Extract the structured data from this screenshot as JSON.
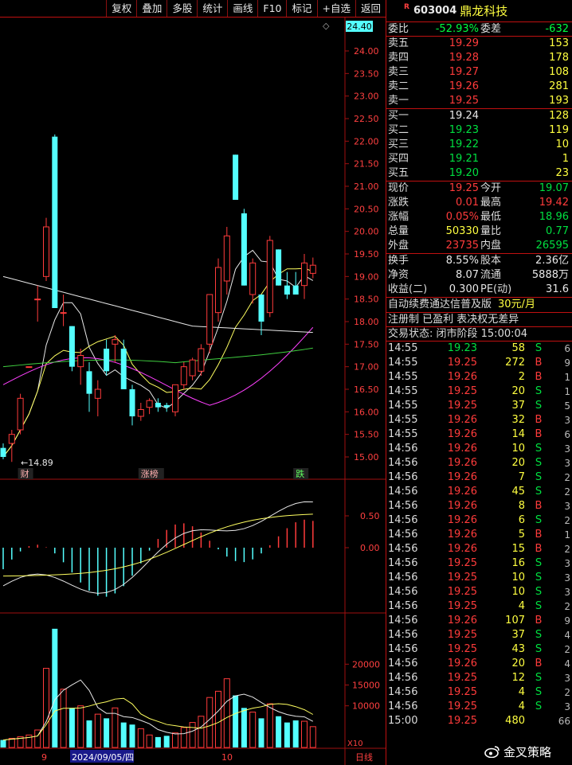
{
  "toolbar": {
    "buttons": [
      "复权",
      "叠加",
      "多股",
      "统计",
      "画线",
      "F10",
      "标记",
      "+自选",
      "返回"
    ]
  },
  "stock": {
    "badge": "R",
    "code": "603004",
    "name": "鼎龙科技"
  },
  "weibi": {
    "label1": "委比",
    "value1": "-52.93%",
    "label2": "委差",
    "value2": "-632"
  },
  "sell": [
    {
      "label": "卖五",
      "price": "19.29",
      "vol": "153"
    },
    {
      "label": "卖四",
      "price": "19.28",
      "vol": "178"
    },
    {
      "label": "卖三",
      "price": "19.27",
      "vol": "108"
    },
    {
      "label": "卖二",
      "price": "19.26",
      "vol": "281"
    },
    {
      "label": "卖一",
      "price": "19.25",
      "vol": "193"
    }
  ],
  "buy": [
    {
      "label": "买一",
      "price": "19.24",
      "vol": "128",
      "color": "white"
    },
    {
      "label": "买二",
      "price": "19.23",
      "vol": "119",
      "color": "green"
    },
    {
      "label": "买三",
      "price": "19.22",
      "vol": "10",
      "color": "green"
    },
    {
      "label": "买四",
      "price": "19.21",
      "vol": "1",
      "color": "green"
    },
    {
      "label": "买五",
      "price": "19.20",
      "vol": "23",
      "color": "green"
    }
  ],
  "quote": [
    {
      "l1": "现价",
      "v1": "19.25",
      "c1": "red",
      "l2": "今开",
      "v2": "19.07",
      "c2": "green"
    },
    {
      "l1": "涨跌",
      "v1": "0.01",
      "c1": "red",
      "l2": "最高",
      "v2": "19.42",
      "c2": "red"
    },
    {
      "l1": "涨幅",
      "v1": "0.05%",
      "c1": "red",
      "l2": "最低",
      "v2": "18.96",
      "c2": "green"
    },
    {
      "l1": "总量",
      "v1": "50330",
      "c1": "yellow",
      "l2": "量比",
      "v2": "0.77",
      "c2": "green"
    },
    {
      "l1": "外盘",
      "v1": "23735",
      "c1": "red",
      "l2": "内盘",
      "v2": "26595",
      "c2": "green"
    }
  ],
  "fundamentals": [
    {
      "l1": "换手",
      "v1": "8.55%",
      "l2": "股本",
      "v2": "2.36亿"
    },
    {
      "l1": "净资",
      "v1": "8.07",
      "l2": "流通",
      "v2": "5888万"
    },
    {
      "l1": "收益(二)",
      "v1": "0.300",
      "l2": "PE(动)",
      "v2": "31.6"
    }
  ],
  "notice": {
    "line1_a": "自动续费通达信普及版",
    "line1_b": "30元/月",
    "line2": "注册制 已盈利 表决权无差异",
    "line3": "交易状态: 闭市阶段 15:00:04"
  },
  "ticks": [
    {
      "t": "14:55",
      "p": "19.23",
      "pc": "green",
      "v": "58",
      "bs": "S",
      "n": "6"
    },
    {
      "t": "14:55",
      "p": "19.25",
      "pc": "red",
      "v": "272",
      "bs": "B",
      "n": "9"
    },
    {
      "t": "14:55",
      "p": "19.26",
      "pc": "red",
      "v": "2",
      "bs": "B",
      "n": "1"
    },
    {
      "t": "14:55",
      "p": "19.25",
      "pc": "red",
      "v": "20",
      "bs": "S",
      "n": "1"
    },
    {
      "t": "14:55",
      "p": "19.25",
      "pc": "red",
      "v": "37",
      "bs": "S",
      "n": "5"
    },
    {
      "t": "14:55",
      "p": "19.26",
      "pc": "red",
      "v": "32",
      "bs": "B",
      "n": "3"
    },
    {
      "t": "14:55",
      "p": "19.26",
      "pc": "red",
      "v": "14",
      "bs": "B",
      "n": "6"
    },
    {
      "t": "14:56",
      "p": "19.26",
      "pc": "red",
      "v": "10",
      "bs": "S",
      "n": "3"
    },
    {
      "t": "14:56",
      "p": "19.26",
      "pc": "red",
      "v": "20",
      "bs": "S",
      "n": "3"
    },
    {
      "t": "14:56",
      "p": "19.26",
      "pc": "red",
      "v": "7",
      "bs": "S",
      "n": "2"
    },
    {
      "t": "14:56",
      "p": "19.26",
      "pc": "red",
      "v": "45",
      "bs": "S",
      "n": "2"
    },
    {
      "t": "14:56",
      "p": "19.26",
      "pc": "red",
      "v": "8",
      "bs": "B",
      "n": "3"
    },
    {
      "t": "14:56",
      "p": "19.26",
      "pc": "red",
      "v": "6",
      "bs": "S",
      "n": "2"
    },
    {
      "t": "14:56",
      "p": "19.26",
      "pc": "red",
      "v": "5",
      "bs": "B",
      "n": "1"
    },
    {
      "t": "14:56",
      "p": "19.26",
      "pc": "red",
      "v": "15",
      "bs": "B",
      "n": "2"
    },
    {
      "t": "14:56",
      "p": "19.25",
      "pc": "red",
      "v": "16",
      "bs": "S",
      "n": "3"
    },
    {
      "t": "14:56",
      "p": "19.25",
      "pc": "red",
      "v": "10",
      "bs": "S",
      "n": "3"
    },
    {
      "t": "14:56",
      "p": "19.25",
      "pc": "red",
      "v": "10",
      "bs": "S",
      "n": "3"
    },
    {
      "t": "14:56",
      "p": "19.25",
      "pc": "red",
      "v": "4",
      "bs": "S",
      "n": "2"
    },
    {
      "t": "14:56",
      "p": "19.26",
      "pc": "red",
      "v": "107",
      "bs": "B",
      "n": "9"
    },
    {
      "t": "14:56",
      "p": "19.25",
      "pc": "red",
      "v": "37",
      "bs": "S",
      "n": "4"
    },
    {
      "t": "14:56",
      "p": "19.25",
      "pc": "red",
      "v": "43",
      "bs": "S",
      "n": "2"
    },
    {
      "t": "14:56",
      "p": "19.26",
      "pc": "red",
      "v": "20",
      "bs": "B",
      "n": "4"
    },
    {
      "t": "14:56",
      "p": "19.25",
      "pc": "red",
      "v": "12",
      "bs": "S",
      "n": "3"
    },
    {
      "t": "14:56",
      "p": "19.25",
      "pc": "red",
      "v": "4",
      "bs": "S",
      "n": "2"
    },
    {
      "t": "14:56",
      "p": "19.25",
      "pc": "red",
      "v": "4",
      "bs": "S",
      "n": "3"
    },
    {
      "t": "15:00",
      "p": "19.25",
      "pc": "red",
      "v": "480",
      "bs": "",
      "n": "66"
    }
  ],
  "chart_data": {
    "type": "candlestick",
    "price_axis": {
      "ticks": [
        "24.00",
        "23.50",
        "23.00",
        "22.50",
        "22.00",
        "21.50",
        "21.00",
        "20.50",
        "20.00",
        "19.50",
        "19.00",
        "18.50",
        "18.00",
        "17.50",
        "17.00",
        "16.50",
        "16.00",
        "15.50",
        "15.00"
      ],
      "current": "24.40",
      "range": [
        14.6,
        24.6
      ]
    },
    "macd_axis": {
      "ticks": [
        "0.50",
        "0.00"
      ]
    },
    "volume_axis": {
      "ticks": [
        "20000",
        "15000",
        "10000"
      ],
      "unit": "X10"
    },
    "low_marker": "14.89",
    "event_tags": [
      {
        "index": 1,
        "text": "财"
      },
      {
        "index": 8,
        "text": "涨榜"
      },
      {
        "index": 17,
        "text": "跌"
      }
    ],
    "x_labels": [
      {
        "index": 3,
        "text": "9"
      },
      {
        "index": 6,
        "text": "2024/09/05/四"
      },
      {
        "index": 17,
        "text": "10"
      },
      {
        "index": 28,
        "text": "日线"
      }
    ],
    "colors": {
      "up": "#ff3b3b",
      "down": "#54ffff",
      "ma5": "#e8e8e8",
      "ma10": "#ffff60",
      "ma20": "#ff40ff",
      "ma60": "#40d040"
    },
    "candles": [
      {
        "o": 15.2,
        "h": 15.3,
        "l": 14.95,
        "c": 15.0
      },
      {
        "o": 15.3,
        "h": 15.6,
        "l": 14.89,
        "c": 15.5
      },
      {
        "o": 15.6,
        "h": 16.4,
        "l": 15.5,
        "c": 16.3
      },
      {
        "o": 17.0,
        "h": 17.0,
        "l": 17.0,
        "c": 17.0
      },
      {
        "o": 18.5,
        "h": 18.8,
        "l": 18.0,
        "c": 18.5
      },
      {
        "o": 19.0,
        "h": 20.3,
        "l": 18.9,
        "c": 20.1
      },
      {
        "o": 22.1,
        "h": 22.15,
        "l": 18.3,
        "c": 18.3
      },
      {
        "o": 18.2,
        "h": 18.6,
        "l": 17.9,
        "c": 18.2
      },
      {
        "o": 17.9,
        "h": 17.9,
        "l": 16.9,
        "c": 17.0
      },
      {
        "o": 17.0,
        "h": 17.4,
        "l": 16.6,
        "c": 17.25
      },
      {
        "o": 16.9,
        "h": 17.1,
        "l": 16.0,
        "c": 16.4
      },
      {
        "o": 16.3,
        "h": 16.7,
        "l": 15.9,
        "c": 16.5
      },
      {
        "o": 17.4,
        "h": 17.6,
        "l": 16.8,
        "c": 16.9
      },
      {
        "o": 17.5,
        "h": 17.7,
        "l": 17.1,
        "c": 17.6
      },
      {
        "o": 17.4,
        "h": 17.6,
        "l": 16.5,
        "c": 16.5
      },
      {
        "o": 16.5,
        "h": 16.6,
        "l": 15.7,
        "c": 15.9
      },
      {
        "o": 15.9,
        "h": 16.2,
        "l": 15.8,
        "c": 16.05
      },
      {
        "o": 16.1,
        "h": 16.3,
        "l": 15.95,
        "c": 16.25
      },
      {
        "o": 16.2,
        "h": 16.3,
        "l": 16.0,
        "c": 16.1
      },
      {
        "o": 16.15,
        "h": 16.2,
        "l": 16.0,
        "c": 16.1
      },
      {
        "o": 16.0,
        "h": 16.6,
        "l": 15.9,
        "c": 16.6
      },
      {
        "o": 16.6,
        "h": 17.1,
        "l": 16.5,
        "c": 17.0
      },
      {
        "o": 16.8,
        "h": 17.2,
        "l": 16.7,
        "c": 17.15
      },
      {
        "o": 16.9,
        "h": 17.5,
        "l": 16.8,
        "c": 17.4
      },
      {
        "o": 17.5,
        "h": 18.6,
        "l": 17.3,
        "c": 18.6
      },
      {
        "o": 18.2,
        "h": 19.4,
        "l": 18.0,
        "c": 19.2
      },
      {
        "o": 18.9,
        "h": 20.1,
        "l": 18.6,
        "c": 19.9
      },
      {
        "o": 21.7,
        "h": 21.7,
        "l": 20.7,
        "c": 20.7
      },
      {
        "o": 20.4,
        "h": 20.5,
        "l": 18.8,
        "c": 18.8
      },
      {
        "o": 18.6,
        "h": 19.4,
        "l": 18.4,
        "c": 19.3
      },
      {
        "o": 18.6,
        "h": 18.6,
        "l": 17.7,
        "c": 18.0
      },
      {
        "o": 18.2,
        "h": 19.9,
        "l": 18.1,
        "c": 19.8
      },
      {
        "o": 19.6,
        "h": 19.6,
        "l": 18.8,
        "c": 18.8
      },
      {
        "o": 18.8,
        "h": 19.1,
        "l": 18.5,
        "c": 18.6
      },
      {
        "o": 18.8,
        "h": 19.1,
        "l": 18.6,
        "c": 18.6
      },
      {
        "o": 18.8,
        "h": 19.5,
        "l": 18.5,
        "c": 19.3
      },
      {
        "o": 19.07,
        "h": 19.42,
        "l": 18.96,
        "c": 19.25
      }
    ]
  }
}
